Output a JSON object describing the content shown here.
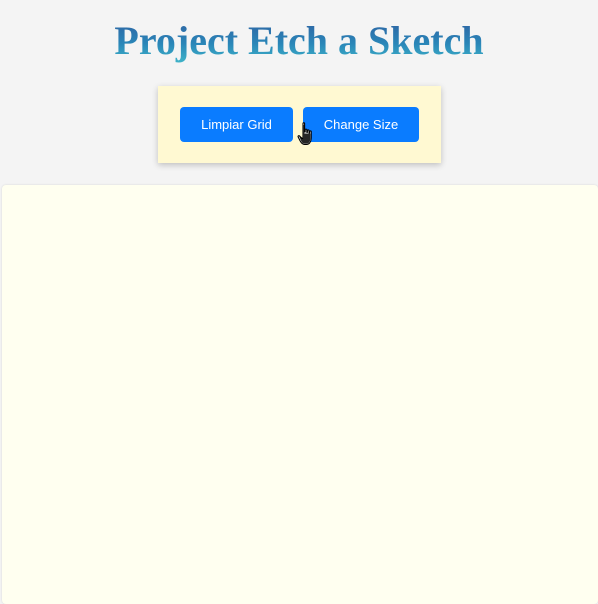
{
  "header": {
    "title": "Project Etch a Sketch"
  },
  "controls": {
    "clear_label": "Limpiar Grid",
    "size_label": "Change Size"
  },
  "cursor": {
    "icon": "hand-pointer-icon"
  },
  "colors": {
    "page_background": "#f4f4f4",
    "controls_background": "#fff9d2",
    "button": "#0a7cff",
    "grid_background": "#fffff0",
    "title_gradient_top": "#2f5fa0",
    "title_gradient_bottom": "#3fb6c9"
  }
}
